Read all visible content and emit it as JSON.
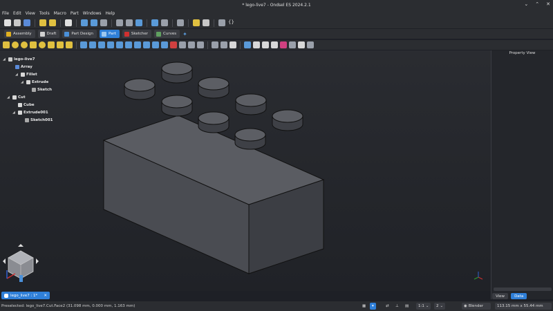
{
  "window": {
    "title": "* lego-live7 - Ondsel ES 2024.2.1"
  },
  "menu": [
    "File",
    "Edit",
    "View",
    "Tools",
    "Macro",
    "Part",
    "Windows",
    "Help"
  ],
  "workbenches": [
    {
      "label": "Assembly",
      "color": "#e0b020",
      "active": false
    },
    {
      "label": "Draft",
      "color": "#d0d0d0",
      "active": false
    },
    {
      "label": "Part Design",
      "color": "#4a90d9",
      "active": false
    },
    {
      "label": "Part",
      "color": "#4a90d9",
      "active": true
    },
    {
      "label": "Sketcher",
      "color": "#d03030",
      "active": false
    },
    {
      "label": "Curves",
      "color": "#60a060",
      "active": false
    }
  ],
  "tree": [
    {
      "label": "lego-live7",
      "depth": 0,
      "arrow": "◢",
      "icon": "document-icon",
      "color": "#cccccc"
    },
    {
      "label": "Array",
      "depth": 1,
      "arrow": "",
      "icon": "array-icon",
      "color": "#5a8ad8"
    },
    {
      "label": "Fillet",
      "depth": 2,
      "arrow": "◢",
      "icon": "fillet-icon",
      "color": "#d8d8d8"
    },
    {
      "label": "Extrude",
      "depth": 3,
      "arrow": "◢",
      "icon": "extrude-icon",
      "color": "#d8d8d8"
    },
    {
      "label": "Sketch",
      "depth": 4,
      "arrow": "",
      "icon": "sketch-icon",
      "color": "#aaaaaa"
    },
    {
      "label": "Cut",
      "depth": 0,
      "arrow": "◢",
      "icon": "cut-icon",
      "color": "#d8d8d8"
    },
    {
      "label": "Cube",
      "depth": 1,
      "arrow": "",
      "icon": "cube-icon",
      "color": "#d8d8d8"
    },
    {
      "label": "Extrude001",
      "depth": 1,
      "arrow": "◢",
      "icon": "extrude-icon",
      "color": "#d8d8d8"
    },
    {
      "label": "Sketch001",
      "depth": 2,
      "arrow": "",
      "icon": "sketch-icon",
      "color": "#aaaaaa"
    }
  ],
  "property_view": {
    "header": "Property View",
    "tabs": [
      "View",
      "Data"
    ],
    "active_tab": "Data"
  },
  "document_tab": {
    "label": "lego_live7 : 1*"
  },
  "status": {
    "message": "Preselected: lego_live7.Cut.Face2 (31.098 mm, 0.000 mm, 1.163 mm)",
    "ratio": "1:1",
    "pages": "2",
    "navigation": "Blender",
    "dimensions": "113.15 mm x 55.44 mm"
  }
}
